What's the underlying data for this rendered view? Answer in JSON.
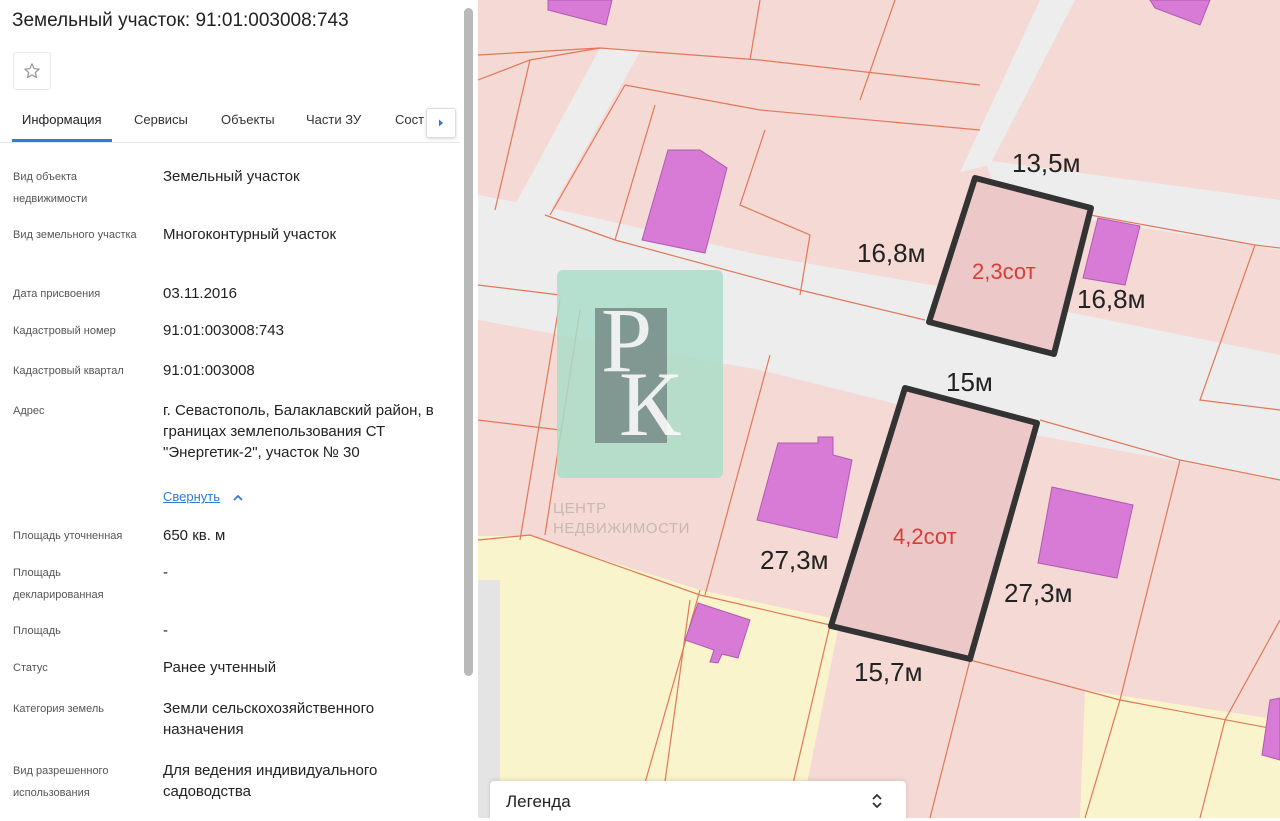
{
  "panel": {
    "title": "Земельный участок: 91:01:003008:743",
    "tabs": [
      "Информация",
      "Сервисы",
      "Объекты",
      "Части ЗУ",
      "Сост"
    ],
    "fields": [
      {
        "label": "Вид объекта недвижимости",
        "value": "Земельный участок"
      },
      {
        "label": "Вид земельного участка",
        "value": "Многоконтурный участок"
      },
      {
        "label": "Дата присвоения",
        "value": "03.11.2016"
      },
      {
        "label": "Кадастровый номер",
        "value": "91:01:003008:743"
      },
      {
        "label": "Кадастровый квартал",
        "value": "91:01:003008"
      },
      {
        "label": "Адрес",
        "value": "г. Севастополь, Балаклавский район, в границах землепользования СТ \"Энергетик-2\", участок № 30"
      },
      {
        "label": "Площадь уточненная",
        "value": "650 кв. м"
      },
      {
        "label": "Площадь декларированная",
        "value": "-"
      },
      {
        "label": "Площадь",
        "value": "-"
      },
      {
        "label": "Статус",
        "value": "Ранее учтенный"
      },
      {
        "label": "Категория земель",
        "value": "Земли сельскохозяйственного назначения"
      },
      {
        "label": "Вид разрешенного использования",
        "value": "Для ведения индивидуального садоводства"
      }
    ],
    "collapse_link": "Свернуть"
  },
  "map": {
    "plot_top": {
      "area": "2,3сот",
      "side_top": "13,5м",
      "side_left": "16,8м",
      "side_right": "16,8м"
    },
    "plot_bottom": {
      "area": "4,2сот",
      "side_top": "15м",
      "side_left": "27,3м",
      "side_right": "27,3м",
      "side_bottom": "15,7м"
    },
    "watermark": {
      "monogram_top": "Р",
      "monogram_bottom": "К",
      "line1": "ЦЕНТР",
      "line2": "НЕДВИЖИМОСТИ"
    },
    "legend_label": "Легенда",
    "colors": {
      "parcel_fill": "#f4d9d4",
      "parcel_line": "#e0785a",
      "building": "#d77bd6",
      "garden": "#faf4cc",
      "road": "#ededed",
      "selected_outline": "#333333",
      "area_text": "#d43f35"
    }
  },
  "icons": {
    "favorite": "star-icon",
    "tabs_more": "chevron-right-icon",
    "collapse": "chevron-up-icon",
    "legend_toggle": "sort-arrows-icon"
  }
}
